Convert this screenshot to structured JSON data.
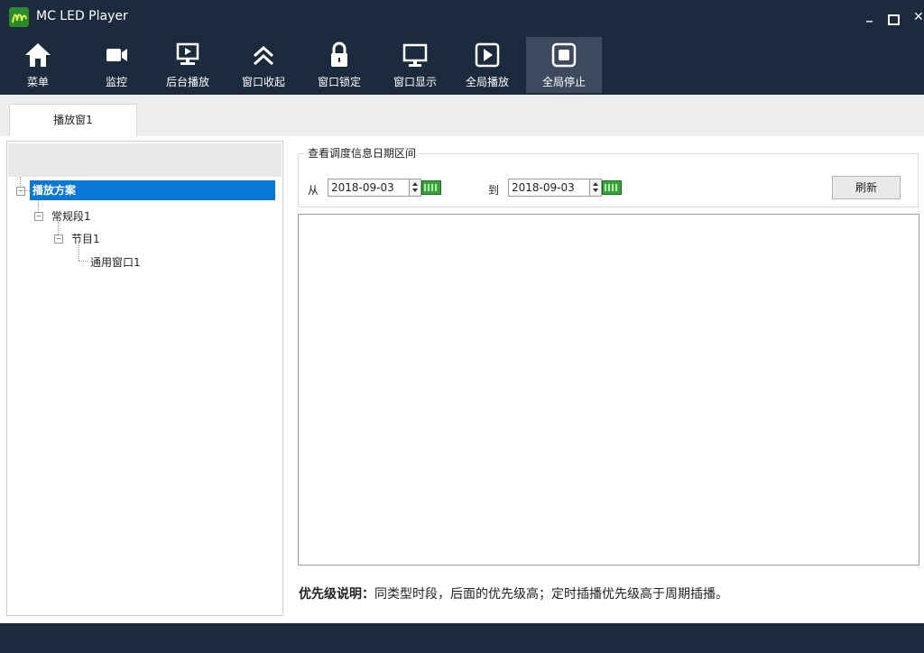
{
  "window": {
    "title": "MC LED Player",
    "controls": {
      "minimize": "_",
      "close": "✕"
    }
  },
  "toolbar": {
    "items": [
      {
        "label": "菜单",
        "icon": "home-icon"
      },
      {
        "label": "监控",
        "icon": "video-camera-icon"
      },
      {
        "label": "后台播放",
        "icon": "background-play-icon"
      },
      {
        "label": "窗口收起",
        "icon": "collapse-icon"
      },
      {
        "label": "窗口锁定",
        "icon": "lock-icon"
      },
      {
        "label": "窗口显示",
        "icon": "monitor-icon"
      },
      {
        "label": "全局播放",
        "icon": "play-icon"
      },
      {
        "label": "全局停止",
        "icon": "stop-icon"
      }
    ],
    "active_index": 7
  },
  "tabs": [
    {
      "label": "播放窗1"
    }
  ],
  "tree": {
    "root": "播放方案",
    "segment": "常规段1",
    "program": "节目1",
    "window": "通用窗口1"
  },
  "schedule": {
    "group_title": "查看调度信息日期区间",
    "from_label": "从",
    "from_value": "2018-09-03",
    "to_label": "到",
    "to_value": "2018-09-03",
    "refresh_label": "刷新"
  },
  "note": {
    "title": "优先级说明：",
    "text": "同类型时段，后面的优先级高；定时插播优先级高于周期插播。"
  },
  "colors": {
    "titlebar_bg": "#1c2a3d",
    "toolbar_active_bg": "#3d4a5d",
    "tree_selected_bg": "#0a78d7"
  }
}
